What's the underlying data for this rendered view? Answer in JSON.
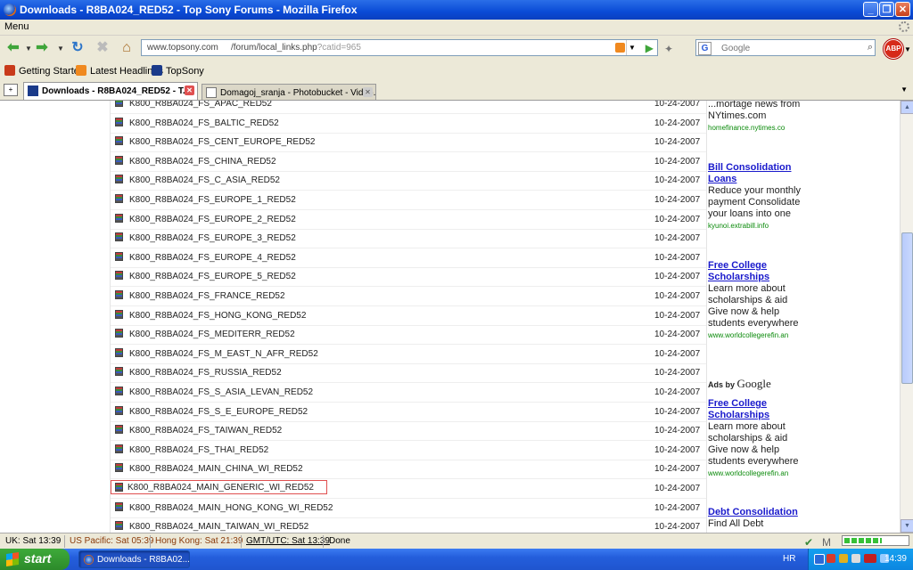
{
  "window": {
    "title": "Downloads - R8BA024_RED52 - Top Sony Forums - Mozilla Firefox"
  },
  "menubar": {
    "menu_label": "Menu"
  },
  "navbar": {
    "url_host": "www.topsony.com",
    "url_path": "/forum/local_links.php",
    "url_query": "?catid=965",
    "search_placeholder": "Google",
    "search_engine_letter": "G",
    "adblock_label": "ABP"
  },
  "bookmarks": [
    {
      "label": "Getting Started",
      "icon": "firefox-red-icon",
      "color": "#c83a1a"
    },
    {
      "label": "Latest Headlines",
      "icon": "rss-icon",
      "color": "#f0891f"
    },
    {
      "label": "TopSony",
      "icon": "topsony-icon",
      "color": "#1a3a8a"
    }
  ],
  "tabs": [
    {
      "label": "Downloads - R8BA024_RED52 - T...",
      "active": true
    },
    {
      "label": "Domagoj_sranja - Photobucket - Video...",
      "active": false
    }
  ],
  "files": [
    {
      "name": "K800_R8BA024_FS_APAC_RED52",
      "date": "10-24-2007"
    },
    {
      "name": "K800_R8BA024_FS_BALTIC_RED52",
      "date": "10-24-2007"
    },
    {
      "name": "K800_R8BA024_FS_CENT_EUROPE_RED52",
      "date": "10-24-2007"
    },
    {
      "name": "K800_R8BA024_FS_CHINA_RED52",
      "date": "10-24-2007"
    },
    {
      "name": "K800_R8BA024_FS_C_ASIA_RED52",
      "date": "10-24-2007"
    },
    {
      "name": "K800_R8BA024_FS_EUROPE_1_RED52",
      "date": "10-24-2007"
    },
    {
      "name": "K800_R8BA024_FS_EUROPE_2_RED52",
      "date": "10-24-2007"
    },
    {
      "name": "K800_R8BA024_FS_EUROPE_3_RED52",
      "date": "10-24-2007"
    },
    {
      "name": "K800_R8BA024_FS_EUROPE_4_RED52",
      "date": "10-24-2007"
    },
    {
      "name": "K800_R8BA024_FS_EUROPE_5_RED52",
      "date": "10-24-2007"
    },
    {
      "name": "K800_R8BA024_FS_FRANCE_RED52",
      "date": "10-24-2007"
    },
    {
      "name": "K800_R8BA024_FS_HONG_KONG_RED52",
      "date": "10-24-2007"
    },
    {
      "name": "K800_R8BA024_FS_MEDITERR_RED52",
      "date": "10-24-2007"
    },
    {
      "name": "K800_R8BA024_FS_M_EAST_N_AFR_RED52",
      "date": "10-24-2007"
    },
    {
      "name": "K800_R8BA024_FS_RUSSIA_RED52",
      "date": "10-24-2007"
    },
    {
      "name": "K800_R8BA024_FS_S_ASIA_LEVAN_RED52",
      "date": "10-24-2007"
    },
    {
      "name": "K800_R8BA024_FS_S_E_EUROPE_RED52",
      "date": "10-24-2007"
    },
    {
      "name": "K800_R8BA024_FS_TAIWAN_RED52",
      "date": "10-24-2007"
    },
    {
      "name": "K800_R8BA024_FS_THAI_RED52",
      "date": "10-24-2007"
    },
    {
      "name": "K800_R8BA024_MAIN_CHINA_WI_RED52",
      "date": "10-24-2007"
    },
    {
      "name": "K800_R8BA024_MAIN_GENERIC_WI_RED52",
      "date": "10-24-2007",
      "highlighted": true
    },
    {
      "name": "K800_R8BA024_MAIN_HONG_KONG_WI_RED52",
      "date": "10-24-2007"
    },
    {
      "name": "K800_R8BA024_MAIN_TAIWAN_WI_RED52",
      "date": "10-24-2007"
    }
  ],
  "ads": {
    "partial_top": {
      "body": "...mortage news from NYtimes.com",
      "url": "homefinance.nytimes.co"
    },
    "items": [
      {
        "title": "Bill Consolidation Loans",
        "body": "Reduce your monthly payment Consolidate your loans into one",
        "url": "kyunoi.extrabill.info"
      },
      {
        "title": "Free College Scholarships",
        "body": "Learn more about scholarships & aid Give now & help students everywhere",
        "url": "www.worldcollegerefin.an"
      },
      {
        "title": "Free College Scholarships",
        "body": "Learn more about scholarships & aid Give now & help students everywhere",
        "url": "www.worldcollegerefin.an"
      },
      {
        "title": "Debt Consolidation",
        "body": "Find All Debt",
        "url": ""
      }
    ],
    "ads_by": "Ads by",
    "google_word": "Google"
  },
  "statusbar": {
    "uk": "UK: Sat 13:39",
    "us_pacific": "US Pacific: Sat 05:39",
    "hong_kong": "Hong Kong: Sat 21:39",
    "gmt": "GMT/UTC: Sat 13:39",
    "status": "Done",
    "progress_fraction": 0.6
  },
  "taskbar": {
    "start_label": "start",
    "task_label": "Downloads - R8BA02...",
    "lang": "HR",
    "clock": "14:39"
  },
  "colors": {
    "link": "#1a1acc",
    "ad_url": "#0a8a0a",
    "highlight_border": "#e05050",
    "us_pacific_text": "#8a3a0a",
    "hong_kong_text": "#8a3a0a"
  }
}
